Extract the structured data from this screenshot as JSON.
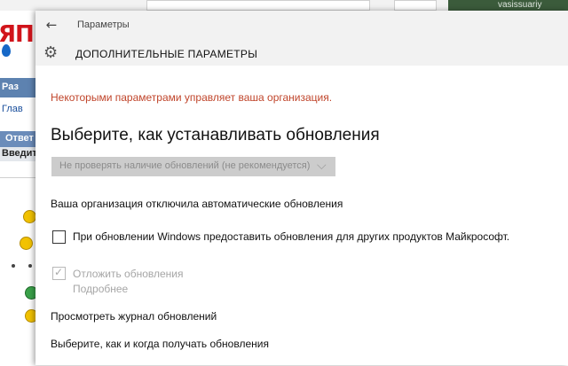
{
  "background_page": {
    "logo_text": "ЯП",
    "nav_label": "Раз",
    "home_link": "Глав",
    "reply_label": "Ответ",
    "enter_label": "Введит",
    "username": "vasissuariy"
  },
  "window": {
    "title": "Параметры",
    "header_title": "ДОПОЛНИТЕЛЬНЫЕ ПАРАМЕТРЫ"
  },
  "settings": {
    "org_note": "Некоторыми параметрами управляет ваша организация.",
    "section_title": "Выберите, как устанавливать обновления",
    "dropdown_value": "Не проверять наличие обновлений (не рекомендуется)",
    "disabled_note": "Ваша организация отключила автоматические обновления",
    "other_products_label": "При обновлении Windows предоставить обновления для других продуктов Майкрософт.",
    "other_products_checked": false,
    "defer_label": "Отложить обновления",
    "defer_checked": true,
    "defer_more": "Подробнее",
    "history_link": "Просмотреть журнал обновлений",
    "delivery_link": "Выберите, как и когда получать обновления"
  },
  "colors": {
    "warning": "#c0452b",
    "disabled_text": "#a6a6a6",
    "chrome_bg": "#f2f2f2"
  }
}
